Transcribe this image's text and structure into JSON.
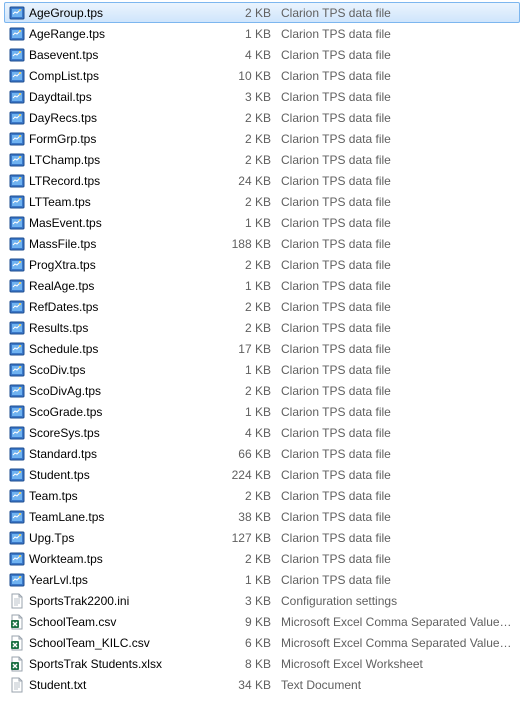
{
  "files": [
    {
      "name": "AgeGroup.tps",
      "size": "2 KB",
      "type": "Clarion TPS data file",
      "icon": "tps",
      "selected": true
    },
    {
      "name": "AgeRange.tps",
      "size": "1 KB",
      "type": "Clarion TPS data file",
      "icon": "tps"
    },
    {
      "name": "Basevent.tps",
      "size": "4 KB",
      "type": "Clarion TPS data file",
      "icon": "tps"
    },
    {
      "name": "CompList.tps",
      "size": "10 KB",
      "type": "Clarion TPS data file",
      "icon": "tps"
    },
    {
      "name": "Daydtail.tps",
      "size": "3 KB",
      "type": "Clarion TPS data file",
      "icon": "tps"
    },
    {
      "name": "DayRecs.tps",
      "size": "2 KB",
      "type": "Clarion TPS data file",
      "icon": "tps"
    },
    {
      "name": "FormGrp.tps",
      "size": "2 KB",
      "type": "Clarion TPS data file",
      "icon": "tps"
    },
    {
      "name": "LTChamp.tps",
      "size": "2 KB",
      "type": "Clarion TPS data file",
      "icon": "tps"
    },
    {
      "name": "LTRecord.tps",
      "size": "24 KB",
      "type": "Clarion TPS data file",
      "icon": "tps"
    },
    {
      "name": "LTTeam.tps",
      "size": "2 KB",
      "type": "Clarion TPS data file",
      "icon": "tps"
    },
    {
      "name": "MasEvent.tps",
      "size": "1 KB",
      "type": "Clarion TPS data file",
      "icon": "tps"
    },
    {
      "name": "MassFile.tps",
      "size": "188 KB",
      "type": "Clarion TPS data file",
      "icon": "tps"
    },
    {
      "name": "ProgXtra.tps",
      "size": "2 KB",
      "type": "Clarion TPS data file",
      "icon": "tps"
    },
    {
      "name": "RealAge.tps",
      "size": "1 KB",
      "type": "Clarion TPS data file",
      "icon": "tps"
    },
    {
      "name": "RefDates.tps",
      "size": "2 KB",
      "type": "Clarion TPS data file",
      "icon": "tps"
    },
    {
      "name": "Results.tps",
      "size": "2 KB",
      "type": "Clarion TPS data file",
      "icon": "tps"
    },
    {
      "name": "Schedule.tps",
      "size": "17 KB",
      "type": "Clarion TPS data file",
      "icon": "tps"
    },
    {
      "name": "ScoDiv.tps",
      "size": "1 KB",
      "type": "Clarion TPS data file",
      "icon": "tps"
    },
    {
      "name": "ScoDivAg.tps",
      "size": "2 KB",
      "type": "Clarion TPS data file",
      "icon": "tps"
    },
    {
      "name": "ScoGrade.tps",
      "size": "1 KB",
      "type": "Clarion TPS data file",
      "icon": "tps"
    },
    {
      "name": "ScoreSys.tps",
      "size": "4 KB",
      "type": "Clarion TPS data file",
      "icon": "tps"
    },
    {
      "name": "Standard.tps",
      "size": "66 KB",
      "type": "Clarion TPS data file",
      "icon": "tps"
    },
    {
      "name": "Student.tps",
      "size": "224 KB",
      "type": "Clarion TPS data file",
      "icon": "tps"
    },
    {
      "name": "Team.tps",
      "size": "2 KB",
      "type": "Clarion TPS data file",
      "icon": "tps"
    },
    {
      "name": "TeamLane.tps",
      "size": "38 KB",
      "type": "Clarion TPS data file",
      "icon": "tps"
    },
    {
      "name": "Upg.Tps",
      "size": "127 KB",
      "type": "Clarion TPS data file",
      "icon": "tps"
    },
    {
      "name": "Workteam.tps",
      "size": "2 KB",
      "type": "Clarion TPS data file",
      "icon": "tps"
    },
    {
      "name": "YearLvl.tps",
      "size": "1 KB",
      "type": "Clarion TPS data file",
      "icon": "tps"
    },
    {
      "name": "SportsTrak2200.ini",
      "size": "3 KB",
      "type": "Configuration settings",
      "icon": "ini"
    },
    {
      "name": "SchoolTeam.csv",
      "size": "9 KB",
      "type": "Microsoft Excel Comma Separated Values ...",
      "icon": "csv"
    },
    {
      "name": "SchoolTeam_KILC.csv",
      "size": "6 KB",
      "type": "Microsoft Excel Comma Separated Values ...",
      "icon": "csv"
    },
    {
      "name": "SportsTrak Students.xlsx",
      "size": "8 KB",
      "type": "Microsoft Excel Worksheet",
      "icon": "xlsx"
    },
    {
      "name": "Student.txt",
      "size": "34 KB",
      "type": "Text Document",
      "icon": "txt"
    }
  ]
}
